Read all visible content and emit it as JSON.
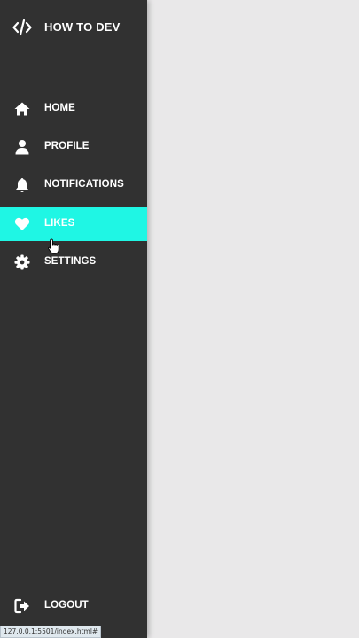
{
  "brand": {
    "label": "HOW TO DEV",
    "icon": "code-icon"
  },
  "nav": {
    "home": {
      "label": "HOME",
      "icon": "home-icon"
    },
    "profile": {
      "label": "PROFILE",
      "icon": "user-icon"
    },
    "notifications": {
      "label": "NOTIFICATIONS",
      "icon": "bell-icon"
    },
    "likes": {
      "label": "LIKES",
      "icon": "heart-icon",
      "active": true
    },
    "settings": {
      "label": "SETTINGS",
      "icon": "gear-icon"
    },
    "logout": {
      "label": "LOGOUT",
      "icon": "sign-out-icon"
    }
  },
  "status_bar": {
    "url": "127.0.0.1:5501/index.html#"
  },
  "colors": {
    "sidebar_bg": "#313131",
    "active_bg": "#1ff6e4",
    "content_bg": "#e9e8e9",
    "text": "#ffffff"
  }
}
